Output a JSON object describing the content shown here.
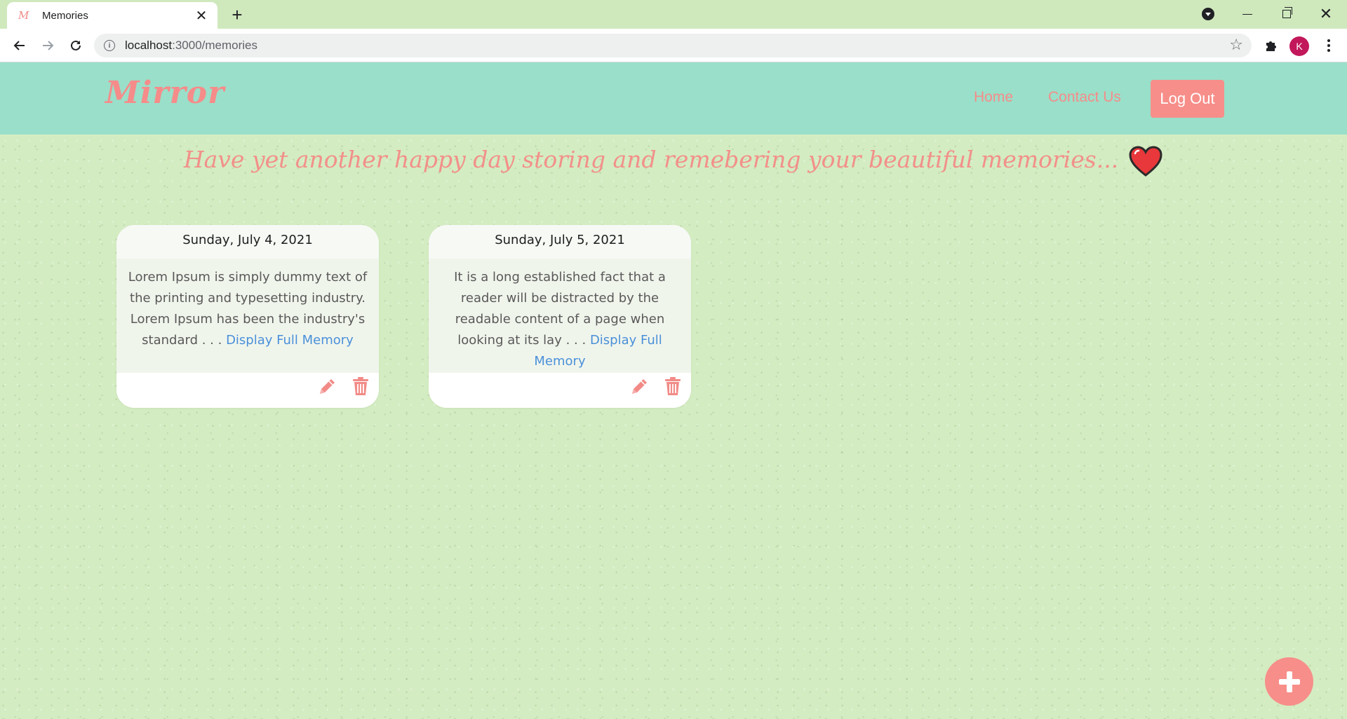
{
  "browser": {
    "tab": {
      "title": "Memories",
      "favicon": "M"
    },
    "url": {
      "host": "localhost",
      "path": ":3000/memories"
    },
    "profile_initial": "K"
  },
  "site": {
    "logo": "Mirror",
    "nav": {
      "home": "Home",
      "contact": "Contact Us",
      "logout": "Log Out"
    },
    "tagline": "Have yet another happy day storing and remebering your beautiful memories..."
  },
  "memories": [
    {
      "date": "Sunday, July 4, 2021",
      "excerpt": "Lorem Ipsum is simply dummy text of the printing and typesetting industry. Lorem Ipsum has been the industry's standard . . .",
      "link": "Display Full Memory"
    },
    {
      "date": "Sunday, July 5, 2021",
      "excerpt": "It is a long established fact that a reader will be distracted by the readable content of a page when looking at its lay . . .",
      "link": "Display Full Memory"
    }
  ],
  "colors": {
    "brand": "#f58c8a",
    "header_bg": "#9adfc9",
    "page_bg": "#d4ecc2",
    "link": "#4a90d9",
    "avatar": "#c2185b"
  },
  "icons": [
    "back-icon",
    "forward-icon",
    "reload-icon",
    "info-icon",
    "star-icon",
    "puzzle-icon",
    "heart-icon",
    "edit-icon",
    "delete-icon",
    "plus-icon"
  ]
}
